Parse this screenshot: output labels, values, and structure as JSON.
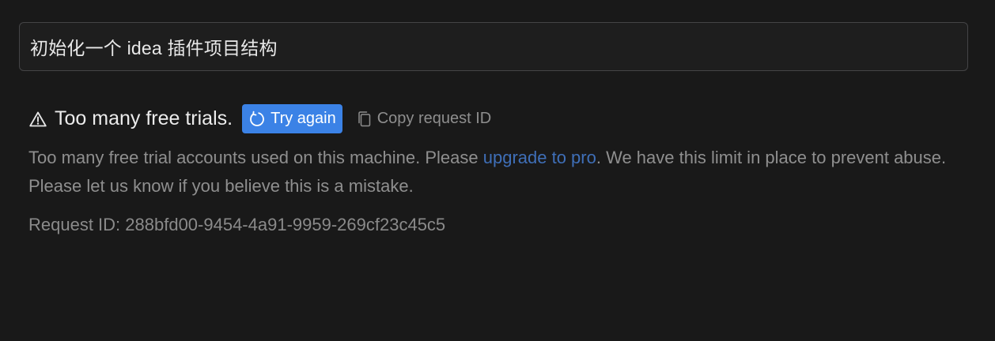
{
  "prompt": {
    "text": "初始化一个 idea 插件项目结构"
  },
  "error": {
    "title": "Too many free trials.",
    "try_again_label": "Try again",
    "copy_request_label": "Copy request ID",
    "message_before_link": "Too many free trial accounts used on this machine. Please ",
    "link_text": "upgrade to pro",
    "message_after_link": ". We have this limit in place to prevent abuse. Please let us know if you believe this is a mistake.",
    "request_id_label": "Request ID: 288bfd00-9454-4a91-9959-269cf23c45c5"
  },
  "icons": {
    "warning": "warning-icon",
    "refresh": "refresh-icon",
    "copy": "copy-icon"
  },
  "colors": {
    "background": "#191919",
    "accent": "#3b82e6",
    "link": "#3f6fb8",
    "muted_text": "#8f8f8f"
  }
}
